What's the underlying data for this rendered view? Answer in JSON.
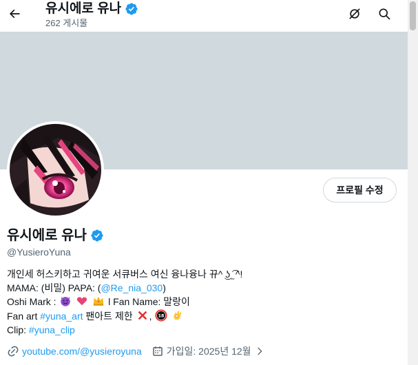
{
  "header": {
    "title": "유시에로 유나",
    "post_count": "262 게시물"
  },
  "profile": {
    "display_name": "유시에로 유나",
    "handle": "@YusieroYuna",
    "edit_button_label": "프로필 수정",
    "verified_color": "#1d9bf0"
  },
  "bio": {
    "line1": "개인세 허스키하고 귀여운 서큐버스 여신 융나융나 뀨^ ͜ʖ ̫͡ ^!",
    "line2_prefix": "MAMA: (비밀) PAPA: (",
    "line2_mention": "@Re_nia_030",
    "line2_suffix": ")",
    "line3_prefix": "Oshi Mark :",
    "line3_suffix": "l Fan Name: 말랑이",
    "line4_prefix": "Fan art ",
    "line4_hashtag": "#yuna_art",
    "line4_suffix": " 팬아트 제한",
    "line5_prefix": "Clip: ",
    "line5_hashtag": "#yuna_clip",
    "emojis": [
      "smiling-devil",
      "heart-sparkle",
      "crown",
      "cross-mark",
      "no-under-18",
      "ok-hand"
    ]
  },
  "meta": {
    "website": "youtube.com/@yusieroyuna",
    "joined": "가입일: 2025년 12월"
  },
  "icons": {
    "back": "arrow-left-icon",
    "grok": "grok-icon",
    "search": "search-icon",
    "verified": "verified-badge-icon",
    "link": "link-icon",
    "calendar": "calendar-icon"
  },
  "colors": {
    "banner": "#cfd9de",
    "accent": "#1d9bf0",
    "secondary_text": "#536471"
  }
}
